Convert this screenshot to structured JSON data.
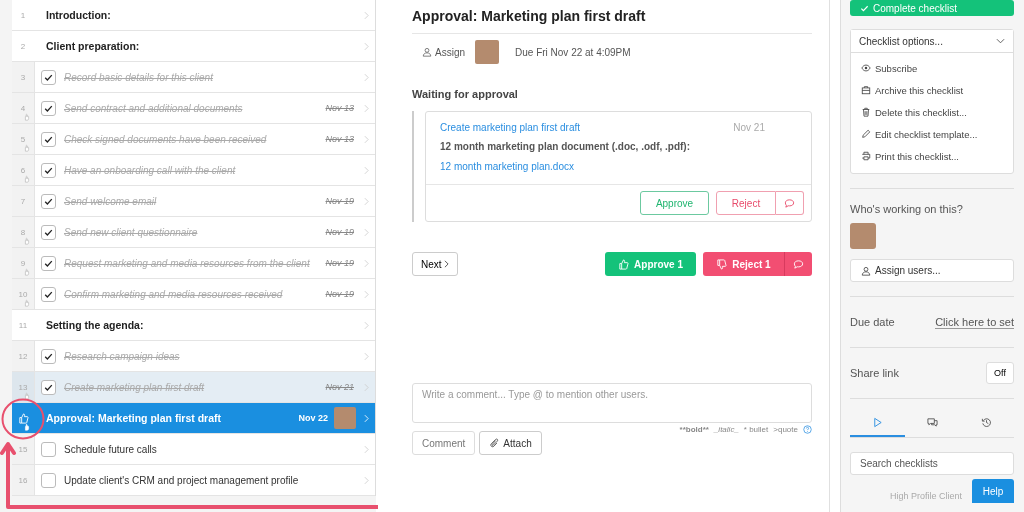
{
  "checklist": {
    "rows": [
      {
        "number": "1",
        "kind": "heading",
        "text": "Introduction:",
        "selected": false,
        "highlighted": false,
        "hand_icon": false
      },
      {
        "number": "2",
        "kind": "heading",
        "text": "Client preparation:",
        "selected": false,
        "highlighted": false,
        "hand_icon": false
      },
      {
        "number": "3",
        "kind": "task",
        "text": "Record basic details for this client",
        "checked": true,
        "selected": false,
        "highlighted": false,
        "hand_icon": false
      },
      {
        "number": "4",
        "kind": "task",
        "text": "Send contract and additional documents",
        "date": "Nov 13",
        "checked": true,
        "selected": false,
        "highlighted": false,
        "hand_icon": true
      },
      {
        "number": "5",
        "kind": "task",
        "text": "Check signed documents have been received",
        "date": "Nov 13",
        "checked": true,
        "selected": false,
        "highlighted": false,
        "hand_icon": true
      },
      {
        "number": "6",
        "kind": "task",
        "text": "Have an onboarding call with the client",
        "checked": true,
        "selected": false,
        "highlighted": false,
        "hand_icon": true
      },
      {
        "number": "7",
        "kind": "task",
        "text": "Send welcome email",
        "date": "Nov 19",
        "checked": true,
        "selected": false,
        "highlighted": false,
        "hand_icon": false
      },
      {
        "number": "8",
        "kind": "task",
        "text": "Send new client questionnaire",
        "date": "Nov 19",
        "checked": true,
        "selected": false,
        "highlighted": false,
        "hand_icon": true
      },
      {
        "number": "9",
        "kind": "task",
        "text": "Request marketing and media resources from the client",
        "date": "Nov 19",
        "checked": true,
        "selected": false,
        "highlighted": false,
        "hand_icon": true
      },
      {
        "number": "10",
        "kind": "task",
        "text": "Confirm marketing and media resources received",
        "date": "Nov 19",
        "checked": true,
        "selected": false,
        "highlighted": false,
        "hand_icon": true
      },
      {
        "number": "11",
        "kind": "heading",
        "text": "Setting the agenda:",
        "selected": false,
        "highlighted": false,
        "hand_icon": false
      },
      {
        "number": "12",
        "kind": "task",
        "text": "Research campaign ideas",
        "checked": true,
        "selected": false,
        "highlighted": false,
        "hand_icon": false
      },
      {
        "number": "13",
        "kind": "task",
        "text": "Create marketing plan first draft",
        "date": "Nov 21",
        "checked": true,
        "selected": false,
        "highlighted": true,
        "hand_icon": true
      },
      {
        "kind": "approval",
        "text": "Approval: Marketing plan first draft",
        "date": "Nov 22",
        "avatar": true,
        "selected": true,
        "highlighted": false,
        "hand_icon": true
      },
      {
        "number": "15",
        "kind": "task",
        "text": "Schedule future calls",
        "checked": false,
        "selected": false,
        "highlighted": false,
        "hand_icon": false
      },
      {
        "number": "16",
        "kind": "task",
        "text": "Update client's CRM and project management profile",
        "checked": false,
        "selected": false,
        "highlighted": false,
        "hand_icon": false
      }
    ]
  },
  "task": {
    "title": "Approval: Marketing plan first draft",
    "assign": "Assign",
    "due": "Due Fri Nov 22 at 4:09PM",
    "section": "Waiting for approval",
    "card": {
      "link": "Create marketing plan first draft",
      "date": "Nov 21",
      "field_label": "12 month marketing plan document (.doc, .odf, .pdf):",
      "file": "12 month marketing plan.docx",
      "approve": "Approve",
      "reject": "Reject"
    },
    "next": "Next",
    "approve_all": "Approve 1",
    "reject_all": "Reject 1",
    "comment": {
      "placeholder": "Write a comment... Type @ to mention other users.",
      "comment_button": "Comment",
      "attach_button": "Attach",
      "hints": [
        {
          "kind": "bold",
          "text": "**bold**"
        },
        {
          "kind": "italic",
          "text": "_italic_"
        },
        {
          "kind": "plain",
          "text": "* bullet"
        },
        {
          "kind": "plain",
          "text": ">quote"
        }
      ]
    }
  },
  "sidebar": {
    "complete": "Complete checklist",
    "options": "Checklist options...",
    "menu": [
      {
        "kind": "eye",
        "label": "Subscribe"
      },
      {
        "kind": "archive",
        "label": "Archive this checklist"
      },
      {
        "kind": "trash",
        "label": "Delete this checklist..."
      },
      {
        "kind": "pencil",
        "label": "Edit checklist template..."
      },
      {
        "kind": "printer",
        "label": "Print this checklist..."
      }
    ],
    "working_title": "Who's working on this?",
    "assign_users": "Assign users...",
    "due_label": "Due date",
    "due_link": "Click here to set",
    "share_label": "Share link",
    "share_toggle": "Off",
    "tabs": [
      {
        "kind": "play",
        "selected": true
      },
      {
        "kind": "comments",
        "selected": false
      },
      {
        "kind": "history",
        "selected": false
      }
    ],
    "search_placeholder": "Search checklists",
    "list_item": "High Profile Client",
    "help": "Help"
  }
}
